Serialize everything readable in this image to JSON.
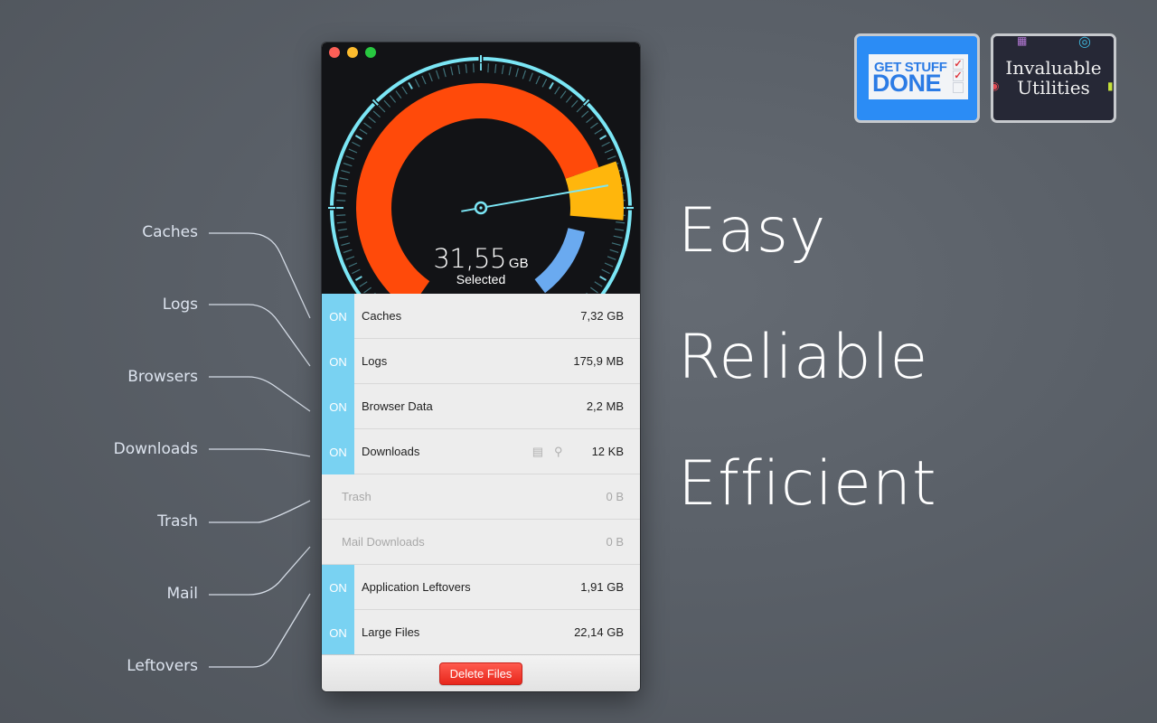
{
  "callouts": [
    {
      "label": "Caches"
    },
    {
      "label": "Logs"
    },
    {
      "label": "Browsers"
    },
    {
      "label": "Downloads"
    },
    {
      "label": "Trash"
    },
    {
      "label": "Mail"
    },
    {
      "label": "Leftovers"
    }
  ],
  "window": {
    "traffic_lights": [
      "close",
      "minimize",
      "maximize"
    ],
    "gauge": {
      "value": "31,55",
      "unit": "GB",
      "caption": "Selected",
      "colors": {
        "ring": "#7be6f5",
        "segment_large_files": "#ff4a0a",
        "segment_caches": "#ffb60c",
        "segment_leftovers": "#6aaaf0",
        "needle": "#7be6f5"
      }
    },
    "items": [
      {
        "toggle": "ON",
        "on": true,
        "name": "Caches",
        "size": "7,32 GB"
      },
      {
        "toggle": "ON",
        "on": true,
        "name": "Logs",
        "size": "175,9 MB"
      },
      {
        "toggle": "ON",
        "on": true,
        "name": "Browser Data",
        "size": "2,2 MB"
      },
      {
        "toggle": "ON",
        "on": true,
        "name": "Downloads",
        "size": "12 KB",
        "icons": [
          "list-icon",
          "search-icon"
        ]
      },
      {
        "toggle": "",
        "on": false,
        "name": "Trash",
        "size": "0 B"
      },
      {
        "toggle": "",
        "on": false,
        "name": "Mail Downloads",
        "size": "0 B"
      },
      {
        "toggle": "ON",
        "on": true,
        "name": "Application Leftovers",
        "size": "1,91 GB"
      },
      {
        "toggle": "ON",
        "on": true,
        "name": "Large Files",
        "size": "22,14 GB"
      }
    ],
    "delete_button": "Delete Files"
  },
  "taglines": [
    "Easy",
    "Reliable",
    "Efficient"
  ],
  "badges": {
    "get_stuff_done": {
      "line1": "GET STUFF",
      "line2": "DONE"
    },
    "invaluable_utilities": {
      "line1": "Invaluable",
      "line2": "Utilities"
    }
  }
}
